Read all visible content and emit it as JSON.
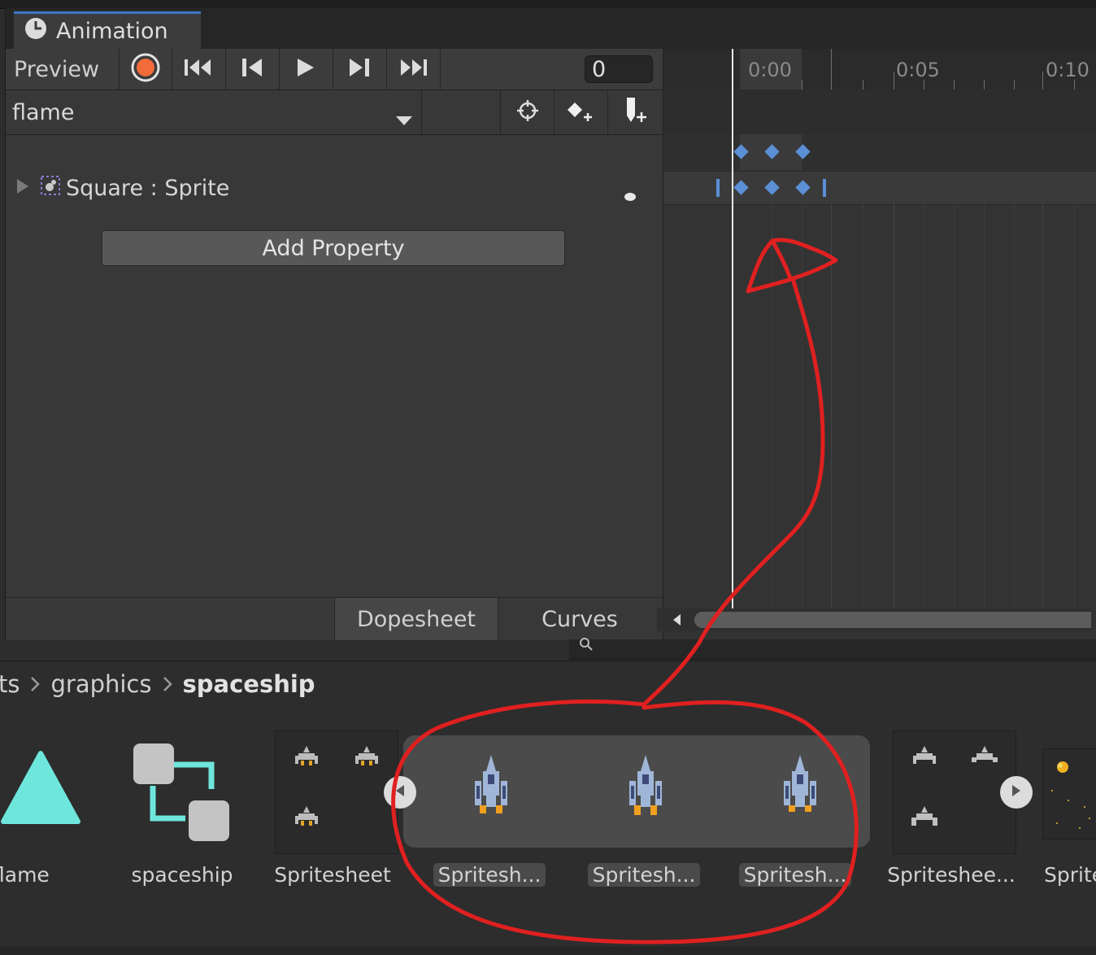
{
  "window": {
    "tab_title": "Animation"
  },
  "toolbar": {
    "preview_label": "Preview",
    "frame_value": "0"
  },
  "clip": {
    "name": "flame"
  },
  "properties": [
    {
      "label": "Square : Sprite"
    }
  ],
  "buttons": {
    "add_property": "Add Property"
  },
  "view_tabs": {
    "dopesheet": "Dopesheet",
    "curves": "Curves"
  },
  "timeline": {
    "labels": [
      "0:00",
      "0:05",
      "0:10"
    ]
  },
  "breadcrumb": {
    "items": [
      "ts",
      "graphics",
      "spaceship"
    ]
  },
  "assets": [
    {
      "label": "flame"
    },
    {
      "label": "spaceship"
    },
    {
      "label": "Spritesheet"
    },
    {
      "label": "Spritesh..."
    },
    {
      "label": "Spritesh..."
    },
    {
      "label": "Spritesh..."
    },
    {
      "label": "Spritesheе..."
    },
    {
      "label": "Sprite"
    }
  ],
  "colors": {
    "record": "#f26b3a",
    "key_blue": "#5b8fd6",
    "annotation": "#e02020",
    "asset_teal": "#6ee6dc"
  },
  "icons": [
    "clock-icon",
    "record-icon",
    "first-key-icon",
    "prev-key-icon",
    "play-icon",
    "next-key-icon",
    "last-key-icon",
    "dropdown-chevron-icon",
    "target-icon",
    "add-keyframe-icon",
    "add-event-icon",
    "expand-arrow-icon",
    "sprite-icon",
    "dot-icon",
    "chevron-right-icon",
    "collapse-icon",
    "expand-icon",
    "search-icon"
  ]
}
